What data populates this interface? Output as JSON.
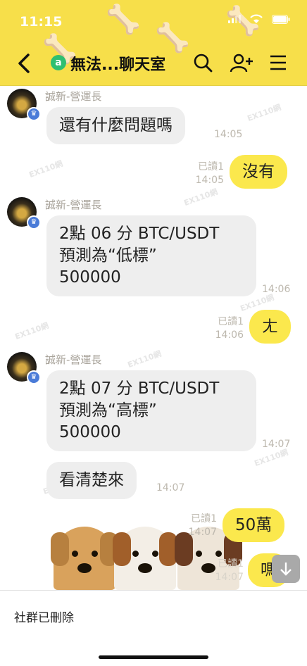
{
  "status_bar": {
    "time": "11:15"
  },
  "header": {
    "title": "無法...聊天室",
    "room_icon_letter": "a",
    "accent": "#f7df4a"
  },
  "messages": [
    {
      "type": "in",
      "sender": "誠新-營運長",
      "lines": [
        "還有什麼問題嗎"
      ],
      "time": "14:05"
    },
    {
      "type": "out",
      "text": "沒有",
      "read": "已讀1",
      "time": "14:05"
    },
    {
      "type": "in",
      "sender": "誠新-營運長",
      "lines": [
        "2點 06 分 BTC/USDT",
        "預測為“低標”",
        "500000"
      ],
      "time": "14:06"
    },
    {
      "type": "out",
      "text": "ㄤ",
      "read": "已讀1",
      "time": "14:06"
    },
    {
      "type": "in",
      "sender": "誠新-營運長",
      "lines": [
        "2點 07 分 BTC/USDT",
        "預測為“高標”",
        "500000"
      ],
      "time": "14:07"
    },
    {
      "type": "in-cont",
      "lines": [
        "看清楚來"
      ],
      "time": "14:07"
    },
    {
      "type": "out",
      "text": "50萬",
      "read": "已讀1",
      "time": "14:07"
    },
    {
      "type": "out",
      "text": "嗎",
      "read": "已讀1",
      "time": "14:07"
    }
  ],
  "bottom": {
    "notice": "社群已刪除"
  },
  "watermark": "EX110網",
  "colors": {
    "in_bubble": "#eeeeee",
    "out_bubble": "#fbe84d",
    "badge": "#4a7bd8"
  }
}
